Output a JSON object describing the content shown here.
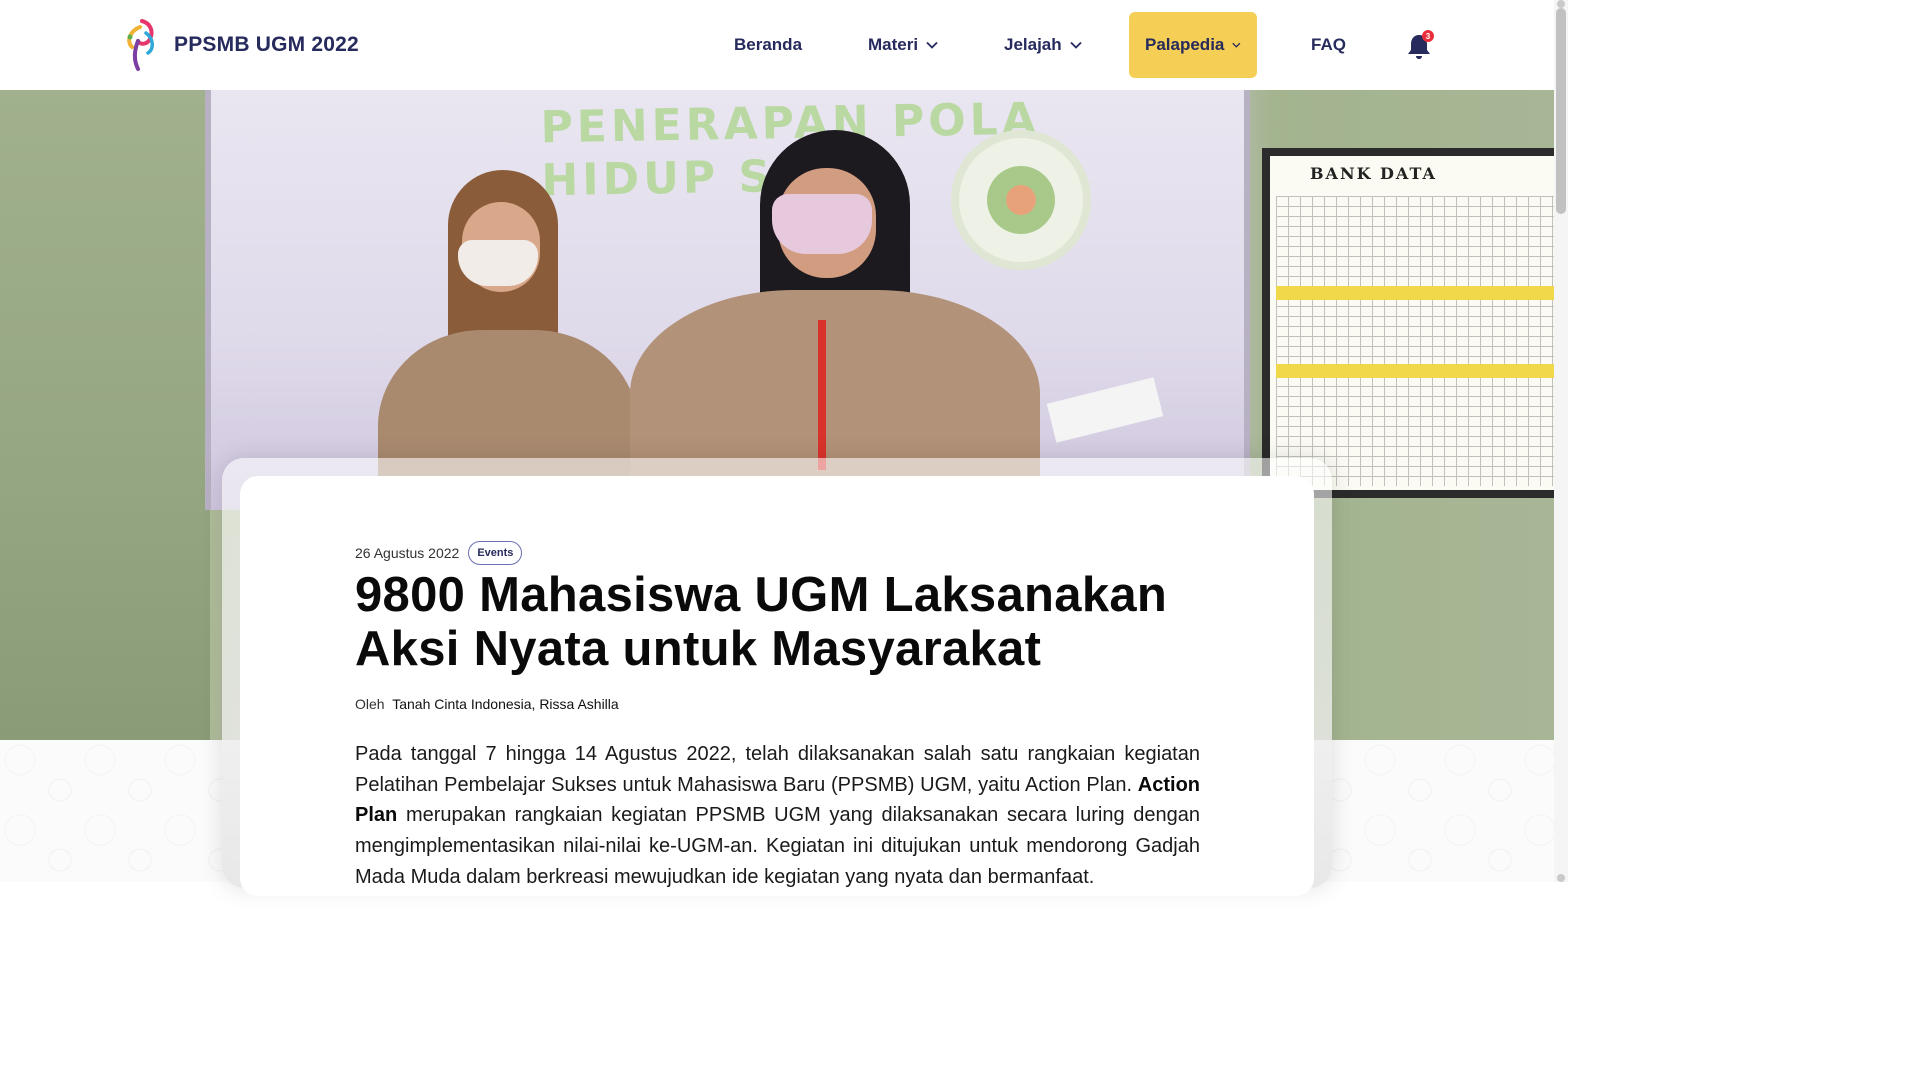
{
  "brand": {
    "name": "PPSMB UGM 2022",
    "logo_icon": "ppsmb-logo-icon"
  },
  "nav": {
    "items": [
      {
        "label": "Beranda",
        "dropdown": false,
        "active": false
      },
      {
        "label": "Materi",
        "dropdown": true,
        "active": false
      },
      {
        "label": "Jelajah",
        "dropdown": true,
        "active": false
      },
      {
        "label": "Palapedia",
        "dropdown": true,
        "active": true
      },
      {
        "label": "FAQ",
        "dropdown": false,
        "active": false
      }
    ],
    "notification": {
      "icon": "bell-icon",
      "count": "3"
    },
    "active_color": "#f5cf55",
    "text_color": "#262a5c"
  },
  "hero": {
    "screen_text_line1": "PENERAPAN POLA",
    "screen_text_line2": "HIDUP SE",
    "board_title": "BANK DATA"
  },
  "article": {
    "date": "26 Agustus 2022",
    "tag": "Events",
    "title": "9800 Mahasiswa UGM Laksanakan Aksi Nyata untuk Masyarakat",
    "byline_prefix": "Oleh",
    "authors": "Tanah Cinta Indonesia, Rissa Ashilla",
    "body_intro": "Pada tanggal 7 hingga 14 Agustus 2022, telah dilaksanakan salah satu rangkaian kegiatan Pelatihan Pembelajar Sukses untuk Mahasiswa Baru (PPSMB) UGM, yaitu Action Plan.",
    "body_bold": "Action Plan",
    "body_rest": "merupakan rangkaian kegiatan PPSMB UGM yang dilaksanakan secara luring dengan mengimplementasikan nilai-nilai ke-UGM-an. Kegiatan ini ditujukan untuk mendorong Gadjah Mada Muda dalam berkreasi mewujudkan ide kegiatan yang nyata dan bermanfaat."
  }
}
